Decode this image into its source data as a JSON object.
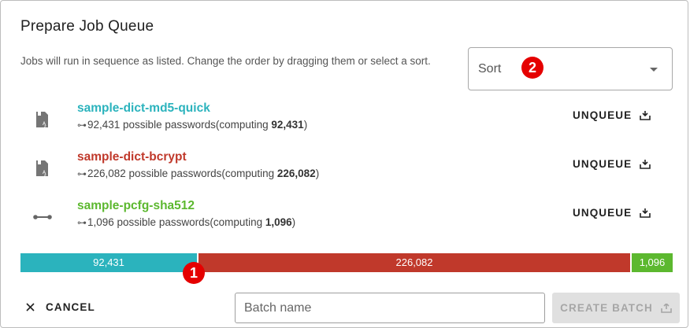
{
  "dialog": {
    "title": "Prepare Job Queue",
    "description": "Jobs will run in sequence as listed. Change the order by dragging them or select a sort."
  },
  "sort": {
    "label": "Sort",
    "badge": "2"
  },
  "jobs": [
    {
      "name": "sample-dict-md5-quick",
      "detail_prefix": "92,431 possible passwords(computing ",
      "detail_count": "92,431",
      "detail_suffix": ")",
      "action": "UNQUEUE",
      "color": "#2bb3bd",
      "icon": "dictionary-file-icon"
    },
    {
      "name": "sample-dict-bcrypt",
      "detail_prefix": "226,082 possible passwords(computing ",
      "detail_count": "226,082",
      "detail_suffix": ")",
      "action": "UNQUEUE",
      "color": "#c0392b",
      "icon": "dictionary-file-icon"
    },
    {
      "name": "sample-pcfg-sha512",
      "detail_prefix": "1,096 possible passwords(computing ",
      "detail_count": "1,096",
      "detail_suffix": ")",
      "action": "UNQUEUE",
      "color": "#5cb82f",
      "icon": "pcfg-connector-icon"
    }
  ],
  "progress": {
    "badge": "1",
    "segments": [
      {
        "label": "92,431",
        "value": 92431,
        "color": "#2bb3bd"
      },
      {
        "label": "226,082",
        "value": 226082,
        "color": "#c0392b"
      },
      {
        "label": "1,096",
        "value": 1096,
        "color": "#5cb82f"
      }
    ]
  },
  "footer": {
    "cancel_label": "CANCEL",
    "batch_placeholder": "Batch name",
    "create_label": "CREATE BATCH"
  }
}
